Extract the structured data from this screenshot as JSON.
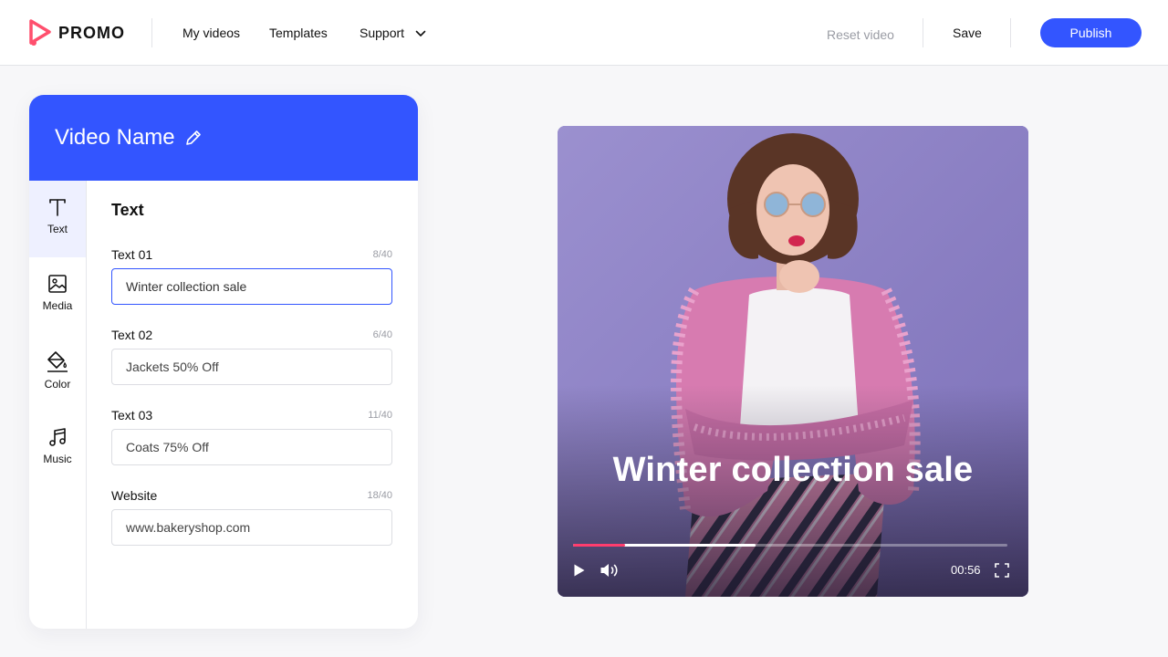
{
  "app": {
    "logo_text": "PROMO",
    "brand_color": "#3355ff",
    "logo_colors": [
      "#ff4f6d",
      "#ff7a3d"
    ]
  },
  "nav": [
    {
      "label": "My videos"
    },
    {
      "label": "Templates"
    },
    {
      "label": "Support",
      "icon": "chevron-down-icon"
    }
  ],
  "actions": {
    "reset_label": "Reset video",
    "save_label": "Save",
    "publish_label": "Publish"
  },
  "panel": {
    "title": "Video Name",
    "title_icon": "pencil-icon",
    "rail": [
      {
        "label": "Text",
        "icon": "text-icon",
        "active": true
      },
      {
        "label": "Media",
        "icon": "image-icon",
        "active": false
      },
      {
        "label": "Color",
        "icon": "paint-bucket-icon",
        "active": false
      },
      {
        "label": "Music",
        "icon": "music-note-icon",
        "active": false
      }
    ],
    "section_title": "Text",
    "fields": [
      {
        "label": "Text 01",
        "count": "8/40",
        "value": "Winter collection sale",
        "focused": true
      },
      {
        "label": "Text 02",
        "count": "6/40",
        "value": "Jackets 50% Off",
        "focused": false
      },
      {
        "label": "Text 03",
        "count": "11/40",
        "value": "Coats 75% Off",
        "focused": false
      },
      {
        "label": "Website",
        "count": "18/40",
        "value": "www.bakeryshop.com",
        "focused": false
      }
    ]
  },
  "video": {
    "overlay_text": "Winter collection sale",
    "time": "00:56",
    "played_fraction": 0.12,
    "buffered_fraction": 0.42,
    "background_color": "#8e83c4",
    "progress_color": "#ff3d6e"
  }
}
